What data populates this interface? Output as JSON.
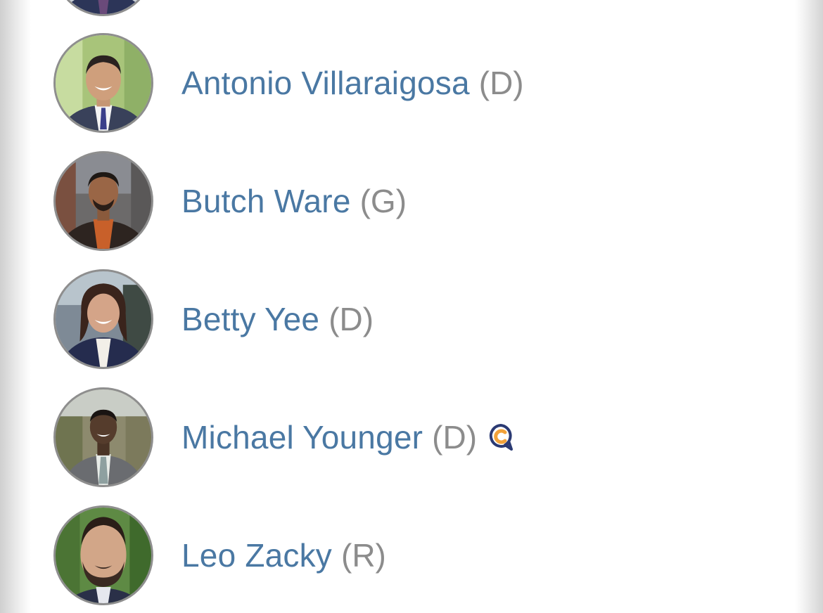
{
  "candidates": [
    {
      "name": "Antonio Villaraigosa",
      "party": "(D)",
      "photo": "avatar-photo"
    },
    {
      "name": "Butch Ware",
      "party": "(G)",
      "photo": "avatar-photo"
    },
    {
      "name": "Betty Yee",
      "party": "(D)",
      "photo": "avatar-photo"
    },
    {
      "name": "Michael Younger",
      "party": "(D)",
      "photo": "avatar-photo",
      "badge": "speech-bubble-c-icon"
    },
    {
      "name": "Leo Zacky",
      "party": "(R)",
      "photo": "avatar-photo"
    }
  ],
  "colors": {
    "name_text": "#4a78a3",
    "party_text": "#8c8c8c",
    "avatar_border": "#8e8e8e",
    "badge_navy": "#2b3a73",
    "badge_orange": "#f2a23a"
  }
}
